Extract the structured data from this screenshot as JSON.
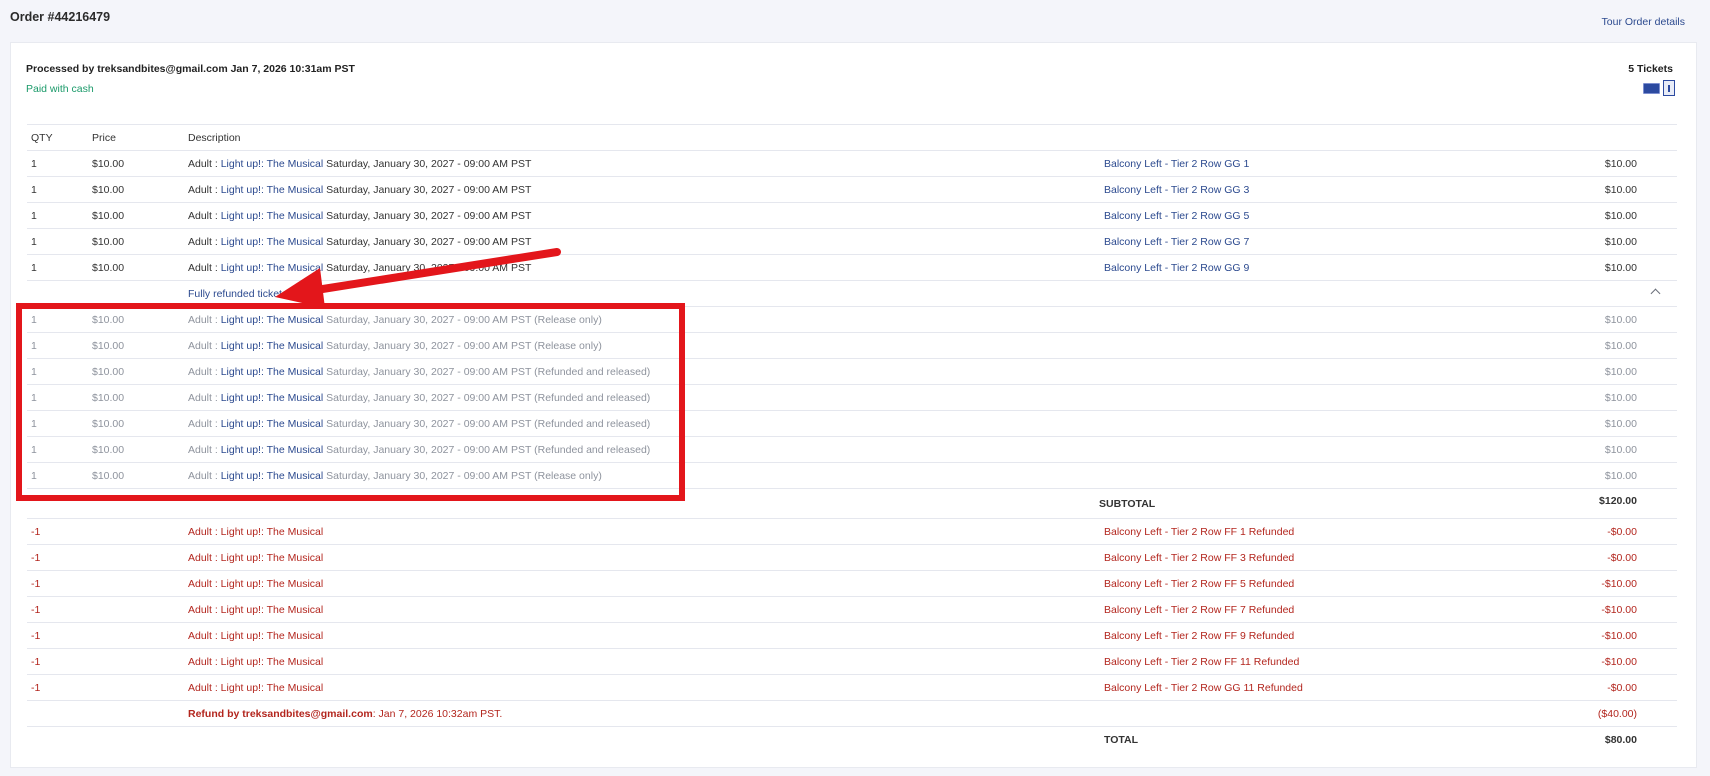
{
  "header": {
    "order_title": "Order #44216479",
    "tour_link": "Tour Order details"
  },
  "summary": {
    "processed_prefix": "Processed by",
    "processed_email": "treksandbites@gmail.com",
    "processed_date": "Jan 7, 2026 10:31am PST",
    "paid_with": "Paid with cash",
    "tickets_count": "5 Tickets"
  },
  "icons": {
    "ticket": "ticket-icon",
    "document": "document-icon"
  },
  "table": {
    "headers": {
      "qty": "QTY",
      "price": "Price",
      "description": "Description"
    },
    "items": [
      {
        "qty": "1",
        "price": "$10.00",
        "type": "Adult : ",
        "show": "Light up!: The Musical",
        "date": " Saturday, January 30, 2027 - 09:00 AM PST",
        "seat": "Balcony Left - Tier 2 Row GG 1",
        "total": "$10.00"
      },
      {
        "qty": "1",
        "price": "$10.00",
        "type": "Adult : ",
        "show": "Light up!: The Musical",
        "date": " Saturday, January 30, 2027 - 09:00 AM PST",
        "seat": "Balcony Left - Tier 2 Row GG 3",
        "total": "$10.00"
      },
      {
        "qty": "1",
        "price": "$10.00",
        "type": "Adult : ",
        "show": "Light up!: The Musical",
        "date": " Saturday, January 30, 2027 - 09:00 AM PST",
        "seat": "Balcony Left - Tier 2 Row GG 5",
        "total": "$10.00"
      },
      {
        "qty": "1",
        "price": "$10.00",
        "type": "Adult : ",
        "show": "Light up!: The Musical",
        "date": " Saturday, January 30, 2027 - 09:00 AM PST",
        "seat": "Balcony Left - Tier 2 Row GG 7",
        "total": "$10.00"
      },
      {
        "qty": "1",
        "price": "$10.00",
        "type": "Adult : ",
        "show": "Light up!: The Musical",
        "date": " Saturday, January 30, 2027 - 09:00 AM PST",
        "seat": "Balcony Left - Tier 2 Row GG 9",
        "total": "$10.00"
      }
    ],
    "refunded_toggle": "Fully refunded tickets",
    "refunded_items": [
      {
        "qty": "1",
        "price": "$10.00",
        "type": "Adult : ",
        "show": "Light up!: The Musical",
        "date": " Saturday, January 30, 2027 - 09:00 AM PST (Release only)",
        "total": "$10.00"
      },
      {
        "qty": "1",
        "price": "$10.00",
        "type": "Adult : ",
        "show": "Light up!: The Musical",
        "date": " Saturday, January 30, 2027 - 09:00 AM PST (Release only)",
        "total": "$10.00"
      },
      {
        "qty": "1",
        "price": "$10.00",
        "type": "Adult : ",
        "show": "Light up!: The Musical",
        "date": " Saturday, January 30, 2027 - 09:00 AM PST (Refunded and released)",
        "total": "$10.00"
      },
      {
        "qty": "1",
        "price": "$10.00",
        "type": "Adult : ",
        "show": "Light up!: The Musical",
        "date": " Saturday, January 30, 2027 - 09:00 AM PST (Refunded and released)",
        "total": "$10.00"
      },
      {
        "qty": "1",
        "price": "$10.00",
        "type": "Adult : ",
        "show": "Light up!: The Musical",
        "date": " Saturday, January 30, 2027 - 09:00 AM PST (Refunded and released)",
        "total": "$10.00"
      },
      {
        "qty": "1",
        "price": "$10.00",
        "type": "Adult : ",
        "show": "Light up!: The Musical",
        "date": " Saturday, January 30, 2027 - 09:00 AM PST (Refunded and released)",
        "total": "$10.00"
      },
      {
        "qty": "1",
        "price": "$10.00",
        "type": "Adult : ",
        "show": "Light up!: The Musical",
        "date": " Saturday, January 30, 2027 - 09:00 AM PST (Release only)",
        "total": "$10.00"
      }
    ],
    "subtotal_label": "SUBTOTAL",
    "subtotal_value": "$120.00",
    "refund_items": [
      {
        "qty": "-1",
        "description": "Adult : Light up!: The Musical",
        "seat": "Balcony Left - Tier 2 Row FF 1 Refunded",
        "total": "-$0.00"
      },
      {
        "qty": "-1",
        "description": "Adult : Light up!: The Musical",
        "seat": "Balcony Left - Tier 2 Row FF 3 Refunded",
        "total": "-$0.00"
      },
      {
        "qty": "-1",
        "description": "Adult : Light up!: The Musical",
        "seat": "Balcony Left - Tier 2 Row FF 5 Refunded",
        "total": "-$10.00"
      },
      {
        "qty": "-1",
        "description": "Adult : Light up!: The Musical",
        "seat": "Balcony Left - Tier 2 Row FF 7 Refunded",
        "total": "-$10.00"
      },
      {
        "qty": "-1",
        "description": "Adult : Light up!: The Musical",
        "seat": "Balcony Left - Tier 2 Row FF 9 Refunded",
        "total": "-$10.00"
      },
      {
        "qty": "-1",
        "description": "Adult : Light up!: The Musical",
        "seat": "Balcony Left - Tier 2 Row FF 11 Refunded",
        "total": "-$10.00"
      },
      {
        "qty": "-1",
        "description": "Adult : Light up!: The Musical",
        "seat": "Balcony Left - Tier 2 Row GG 11 Refunded",
        "total": "-$0.00"
      }
    ],
    "refund_by_label": "Refund by treksandbites@gmail.com",
    "refund_by_date": ": Jan 7, 2026 10:32am PST.",
    "refund_total": "($40.00)",
    "total_label": "TOTAL",
    "total_value": "$80.00"
  },
  "colors": {
    "link": "#2c4a8f",
    "refund_red": "#b3261e",
    "paid_green": "#1b9a6a",
    "annotation_red": "#e3161b"
  }
}
